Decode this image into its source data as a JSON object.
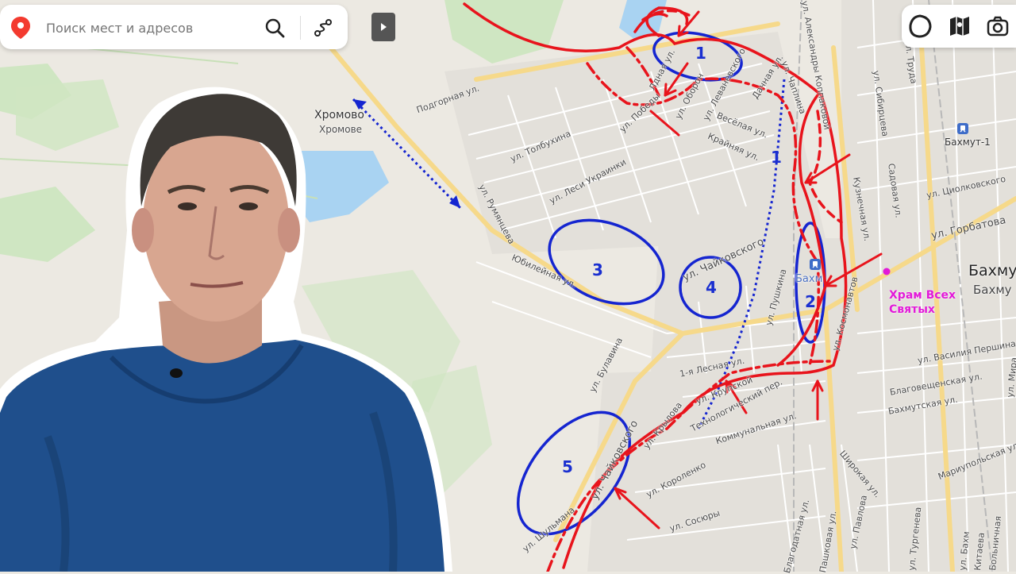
{
  "search": {
    "placeholder": "Поиск мест и адресов",
    "icon": "search-icon",
    "pin_icon": "map-pin-icon",
    "route_icon": "route-icon"
  },
  "panel": {
    "toggle_icon": "play-icon"
  },
  "toolbar": {
    "items": [
      {
        "name": "layers-icon"
      },
      {
        "name": "map-book-icon"
      },
      {
        "name": "camera-icon"
      }
    ]
  },
  "colors": {
    "front_line": "#e8141c",
    "zones": "#1525d0",
    "church_label": "#e21ad8",
    "map_bg": "#ece9e2",
    "green_area": "#cfe6c2",
    "water": "#a9d3f2"
  },
  "places": {
    "khromovo_large": "Хромово",
    "khromovo_small": "Хромове",
    "bakhmut_large": "Бахму",
    "bakhmut_small": "Бахму",
    "bakhmut_1": "Бахмут-1",
    "station_short": "Бахм",
    "church": [
      "Храм Всех",
      "Святых"
    ]
  },
  "zones": [
    "1",
    "1",
    "2",
    "3",
    "4",
    "5"
  ],
  "streets": [
    "Подгорная ул.",
    "ул. Толбухина",
    "ул. Победы",
    "ул. Оборон",
    "ул. Леваневского",
    "Лдная ул.",
    "Весёлая ул.",
    "Крайняя ул.",
    "Дачная ул.",
    "ул. Чаплина",
    "ул. Александры Коппаковой",
    "ул. Леси Украинки",
    "ул. Румянцева",
    "Юбилейная ул.",
    "ул. Чайковского",
    "ул. Пушкина",
    "ул. Космонавтов",
    "1-я Лесная ул.",
    "ул. Крупской",
    "ул. Булавина",
    "ул. Чайковского",
    "ул. Крылова",
    "Технологический пер.",
    "Коммунальная ул.",
    "ул. Короленко",
    "ул. Сосюры",
    "ул. Шульмана",
    "ул. Горбатова",
    "ул. Циолковского",
    "ул. Сибирцева",
    "Садовая ул.",
    "Кузнечная ул.",
    "ул. Труда",
    "ул. Василия Першина",
    "Благовещенская ул.",
    "Бахмутская ул.",
    "Мариупольская ул.",
    "Широкая ул.",
    "Благодатная ул.",
    "Пашковая ул.",
    "ул. Павлова",
    "ул. Тургенева",
    "Китаева",
    "Больничная",
    "ул. Мира",
    "ул. Бахм"
  ]
}
